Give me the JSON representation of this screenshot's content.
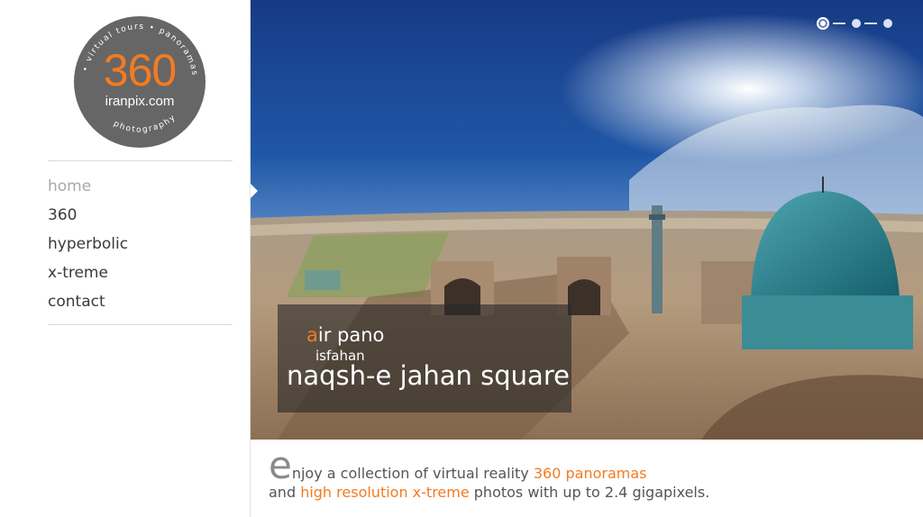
{
  "logo": {
    "number": "360",
    "domain": "iranpix.com",
    "ring_top": "• virtual tours • panoramas",
    "ring_bottom": "photography",
    "colors": {
      "circle": "#666666",
      "accent": "#f47b20"
    }
  },
  "nav": {
    "items": [
      {
        "label": "home",
        "active": true
      },
      {
        "label": "360"
      },
      {
        "label": "hyperbolic"
      },
      {
        "label": "x-treme"
      },
      {
        "label": "contact"
      }
    ]
  },
  "slider": {
    "dots": {
      "count": 3,
      "active_index": 0
    },
    "caption": {
      "title_first_letter": "a",
      "title_rest": "ir pano",
      "subtitle": "isfahan",
      "heading": "naqsh-e jahan square"
    }
  },
  "intro": {
    "drop_letter": "e",
    "text1": "njoy a collection of virtual reality ",
    "highlight1": "360 panoramas",
    "text2": "and ",
    "highlight2": "high resolution x-treme",
    "text3": " photos with up to 2.4 gigapixels."
  },
  "colors": {
    "accent": "#f47b20",
    "text": "#3a3a3a",
    "muted": "#a8a8a8"
  }
}
